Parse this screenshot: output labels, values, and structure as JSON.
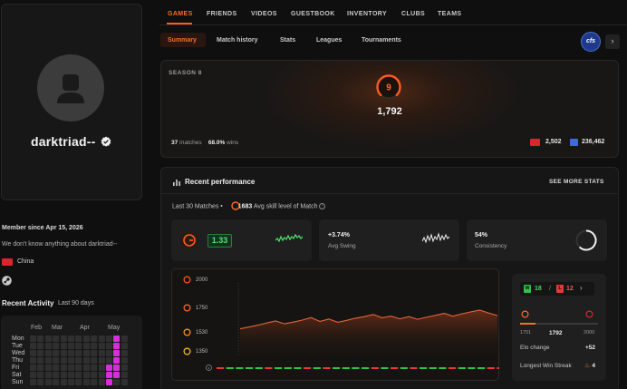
{
  "profile": {
    "username": "darktriad--",
    "member_since": "Member since Apr 15, 2026",
    "bio": "We don't know anything about darktriad--",
    "country": "China"
  },
  "recent_activity": {
    "title": "Recent Activity",
    "subtitle": "Last 90 days",
    "months": [
      "Feb",
      "Mar",
      "Apr",
      "May"
    ],
    "days": [
      "Mon",
      "Tue",
      "Wed",
      "Thu",
      "Fri",
      "Sat",
      "Sun"
    ]
  },
  "nav": {
    "tabs": [
      "GAMES",
      "FRIENDS",
      "VIDEOS",
      "GUESTBOOK",
      "INVENTORY",
      "CLUBS",
      "TEAMS"
    ],
    "sub_tabs": [
      "Summary",
      "Match history",
      "Stats",
      "Leagues",
      "Tournaments"
    ],
    "game_logo": "cfs",
    "more": "›"
  },
  "season": {
    "label": "SEASON 8",
    "level": "9",
    "elo": "1,792",
    "matches_count": "37",
    "matches_label": "matches",
    "winrate": "68.0%",
    "winrate_label": "wins",
    "country_rank": "2,502",
    "world_rank": "236,462"
  },
  "performance": {
    "title": "Recent performance",
    "see_more": "SEE MORE STATS",
    "last_matches": "Last 30 Matches •",
    "avg_skill": "1683",
    "avg_skill_label": "Avg skill level of Match",
    "elo_card_value": "1.33",
    "avg_swing_value": "+3.74%",
    "avg_swing_label": "Avg Swing",
    "consistency_value": "54%",
    "consistency_label": "Consistency"
  },
  "elo_chart": {
    "y_ticks": [
      "2000",
      "1750",
      "1530",
      "1350"
    ],
    "results": [
      "L",
      "W",
      "W",
      "W",
      "W",
      "L",
      "W",
      "W",
      "W",
      "L",
      "W",
      "L",
      "W",
      "W",
      "W",
      "W",
      "L",
      "W",
      "L",
      "W",
      "L",
      "W",
      "W",
      "W",
      "L",
      "W",
      "W",
      "W",
      "L",
      "L"
    ]
  },
  "chart_data": {
    "type": "line",
    "title": "",
    "xlabel": "",
    "ylabel": "",
    "y_ticks": [
      "2000",
      "1750",
      "1530",
      "1350"
    ],
    "series": [
      {
        "values": [
          1704,
          1712,
          1721,
          1731,
          1740,
          1727,
          1735,
          1744,
          1756,
          1738,
          1749,
          1734,
          1743,
          1753,
          1760,
          1770,
          1755,
          1762,
          1750,
          1760,
          1748,
          1757,
          1766,
          1775,
          1762,
          1773,
          1782,
          1790,
          1777,
          1765
        ]
      }
    ]
  },
  "win_loss": {
    "wins": "18",
    "losses": "12",
    "w_tag": "W",
    "l_tag": "L",
    "separator": "/",
    "range_low": "1751",
    "range_current": "1792",
    "range_high": "2000",
    "range_progress": 0.2,
    "elo_change_label": "Elo change",
    "elo_change_value": "+52",
    "streak_label": "Longest Win Streak",
    "streak_value": "4"
  },
  "colors": {
    "accent": "#ff5a1f",
    "win": "#2cc44a",
    "loss": "#e23a3a",
    "activity_on": "#d62fd9"
  }
}
